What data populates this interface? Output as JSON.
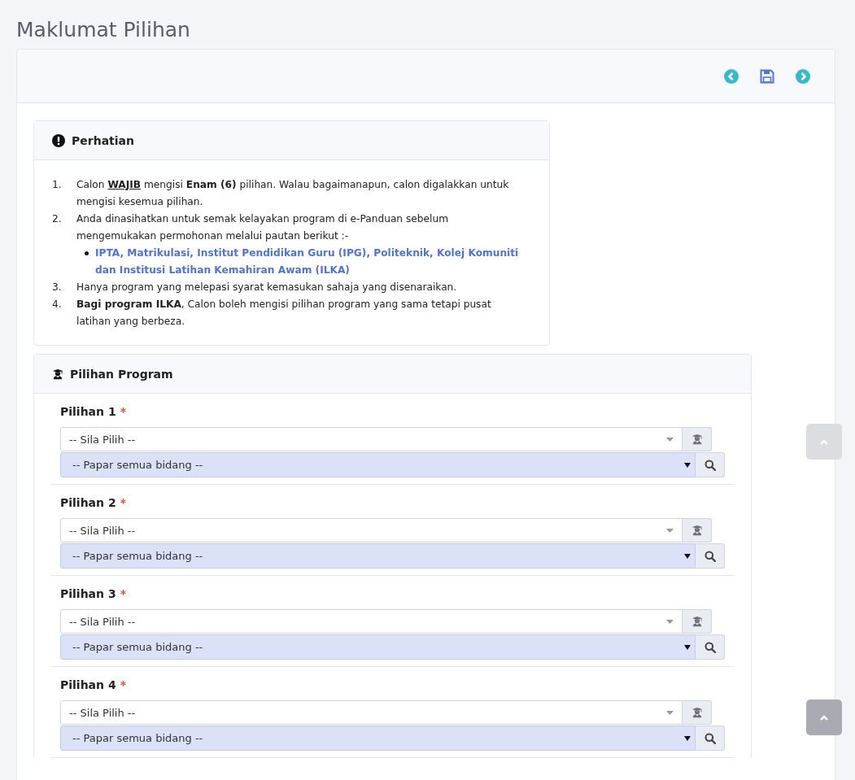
{
  "page_title": "Maklumat Pilihan",
  "notice": {
    "title": "Perhatian",
    "items": [
      {
        "number": "1.",
        "segments": [
          {
            "kind": "plain",
            "text": "Calon "
          },
          {
            "kind": "underline",
            "text": "WAJIB"
          },
          {
            "kind": "plain",
            "text": " mengisi **Enam (6)** pilihan. Walau bagaimanapun, calon digalakkan untuk mengisi kesemua pilihan."
          }
        ]
      },
      {
        "number": "2.",
        "segments": [
          {
            "kind": "plain",
            "text": "Anda dinasihatkan untuk semak kelayakan program di e-Panduan sebelum mengemukakan permohonan melalui pautan berikut :-"
          }
        ],
        "links": [
          "IPTA, Matrikulasi, Institut Pendidikan Guru (IPG), Politeknik, Kolej Komuniti dan Institusi Latihan Kemahiran Awam (ILKA)"
        ]
      },
      {
        "number": "3.",
        "segments": [
          {
            "kind": "plain",
            "text": "Hanya program yang melepasi syarat kemasukan sahaja yang disenaraikan."
          }
        ]
      },
      {
        "number": "4.",
        "segments": [
          {
            "kind": "plain",
            "text": "**Bagi program ILKA**, Calon boleh mengisi pilihan program yang sama tetapi pusat latihan yang berbeza."
          }
        ]
      }
    ]
  },
  "programs": {
    "title": "Pilihan Program",
    "choices": [
      {
        "label": "Pilihan 1",
        "required_mark": "*",
        "program_select": "-- Sila Pilih --",
        "field_select": "-- Papar semua bidang --"
      },
      {
        "label": "Pilihan 2",
        "required_mark": "*",
        "program_select": "-- Sila Pilih --",
        "field_select": "-- Papar semua bidang --"
      },
      {
        "label": "Pilihan 3",
        "required_mark": "*",
        "program_select": "-- Sila Pilih --",
        "field_select": "-- Papar semua bidang --"
      },
      {
        "label": "Pilihan 4",
        "required_mark": "*",
        "program_select": "-- Sila Pilih --",
        "field_select": "-- Papar semua bidang --"
      }
    ]
  }
}
